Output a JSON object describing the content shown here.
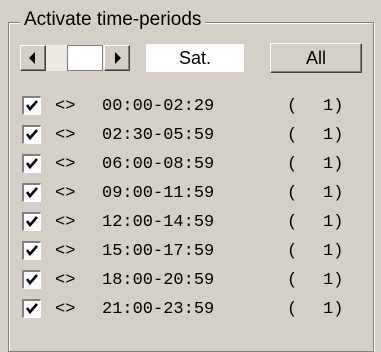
{
  "group": {
    "title": "Activate time-periods"
  },
  "day_selector": {
    "day": "Sat.",
    "all_label": "All"
  },
  "periods": [
    {
      "checked": true,
      "marker": "<>",
      "range": "00:00-02:29",
      "open": "(",
      "count": "1)"
    },
    {
      "checked": true,
      "marker": "<>",
      "range": "02:30-05:59",
      "open": "(",
      "count": "1)"
    },
    {
      "checked": true,
      "marker": "<>",
      "range": "06:00-08:59",
      "open": "(",
      "count": "1)"
    },
    {
      "checked": true,
      "marker": "<>",
      "range": "09:00-11:59",
      "open": "(",
      "count": "1)"
    },
    {
      "checked": true,
      "marker": "<>",
      "range": "12:00-14:59",
      "open": "(",
      "count": "1)"
    },
    {
      "checked": true,
      "marker": "<>",
      "range": "15:00-17:59",
      "open": "(",
      "count": "1)"
    },
    {
      "checked": true,
      "marker": "<>",
      "range": "18:00-20:59",
      "open": "(",
      "count": "1)"
    },
    {
      "checked": true,
      "marker": "<>",
      "range": "21:00-23:59",
      "open": "(",
      "count": "1)"
    }
  ]
}
